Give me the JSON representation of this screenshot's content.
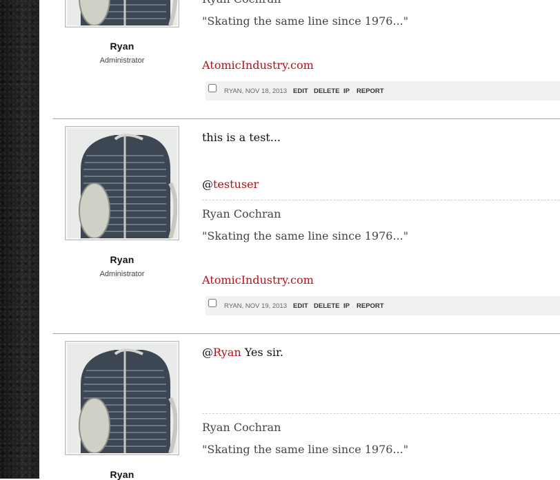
{
  "posts": [
    {
      "username": "Ryan",
      "role": "Administrator",
      "sig_name": "Ryan Cochran",
      "sig_quote": "\"Skating the same line since 1976...\"",
      "sig_link": "AtomicIndustry.com",
      "meta": {
        "author_date": "RYAN, NOV 18, 2013",
        "edit": "EDIT",
        "delete": "DELETE",
        "ip": "IP",
        "report": "REPORT"
      }
    },
    {
      "username": "Ryan",
      "role": "Administrator",
      "body_line1": "this is a test...",
      "mention_at": "@",
      "mention_user": "testuser",
      "sig_name": "Ryan Cochran",
      "sig_quote": "\"Skating the same line since 1976...\"",
      "sig_link": "AtomicIndustry.com",
      "meta": {
        "author_date": "RYAN, NOV 19, 2013",
        "edit": "EDIT",
        "delete": "DELETE",
        "ip": "IP",
        "report": "REPORT"
      }
    },
    {
      "username": "Ryan",
      "role": "",
      "mention_at": "@",
      "mention_user": "Ryan",
      "body_rest": " Yes sir.",
      "sig_name": "Ryan Cochran",
      "sig_quote": "\"Skating the same line since 1976...\""
    }
  ],
  "colors": {
    "link": "#b0121b",
    "meta_bar_bg": "#f1f1f1",
    "separator": "#a9a9a9"
  },
  "icons": {
    "avatar": "car-grille-avatar"
  }
}
